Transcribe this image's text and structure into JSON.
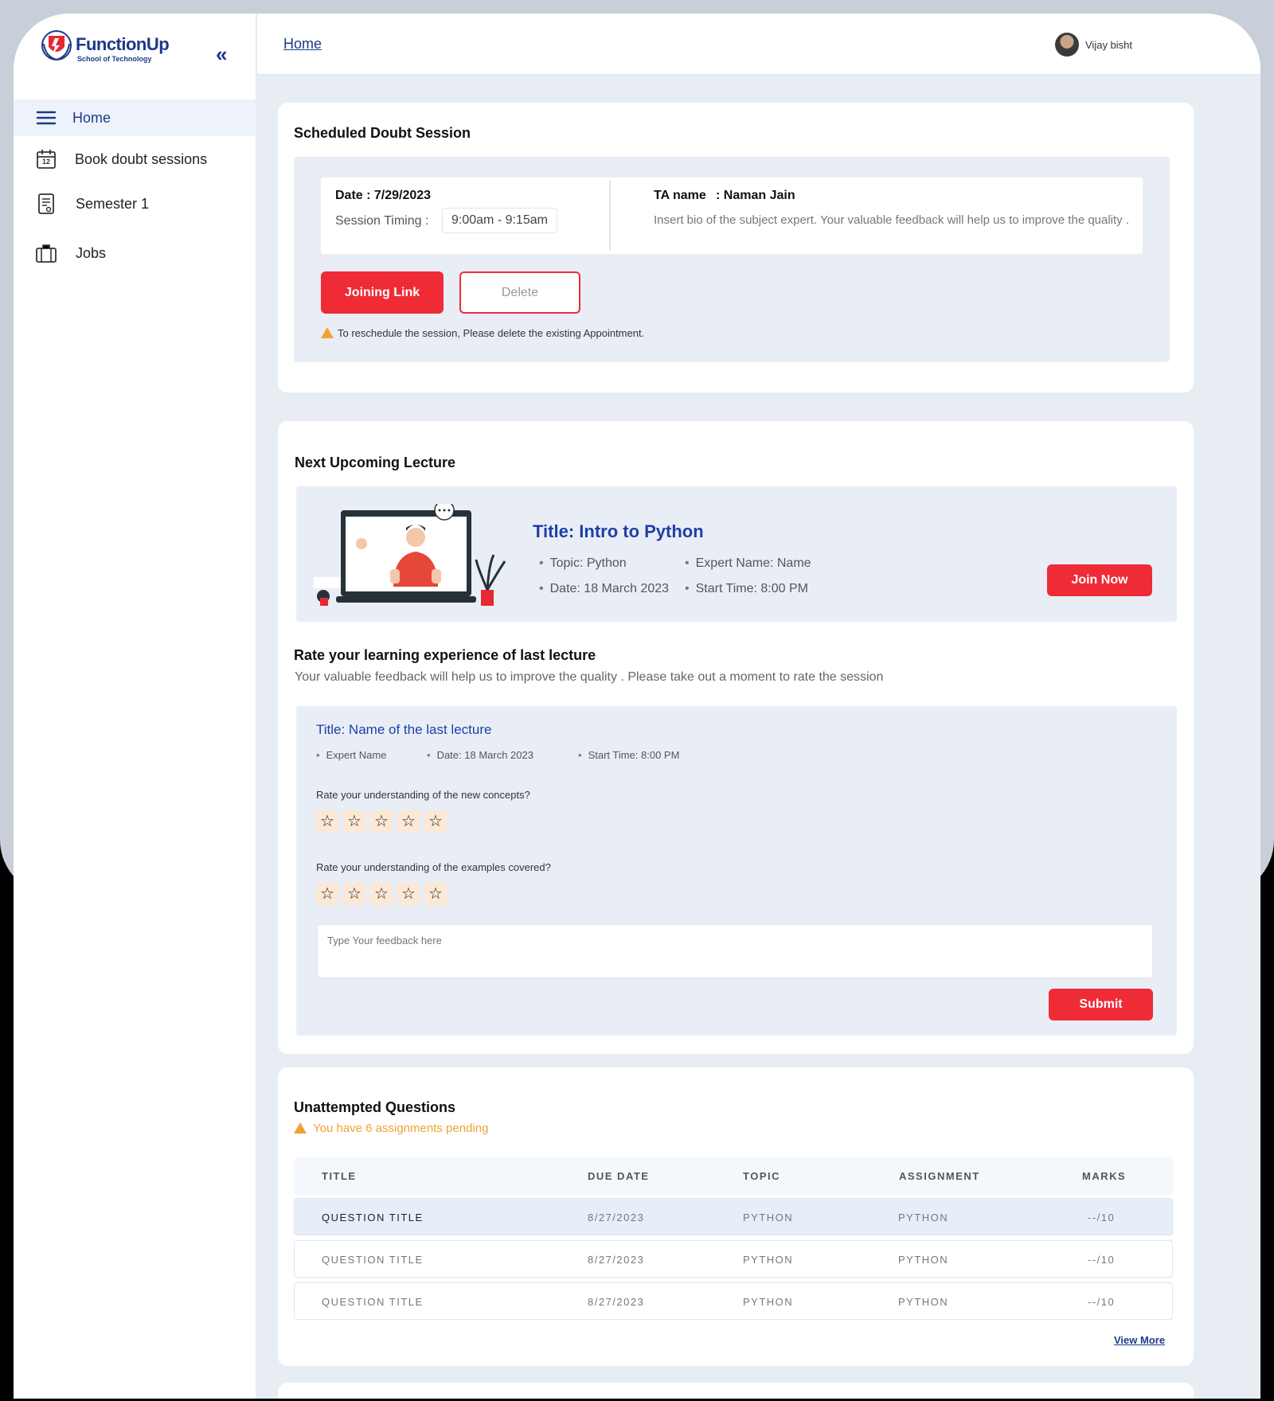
{
  "brand": {
    "name": "FunctionUp",
    "tagline": "School of Technology"
  },
  "sidebar": {
    "items": [
      {
        "label": "Home",
        "icon": "menu-icon",
        "active": true
      },
      {
        "label": "Book doubt sessions",
        "icon": "calendar-icon",
        "calendar_day": "12"
      },
      {
        "label": "Semester 1",
        "icon": "certificate-icon"
      },
      {
        "label": "Jobs",
        "icon": "briefcase-icon"
      }
    ]
  },
  "header": {
    "breadcrumb": "Home",
    "user_name": "Vijay bisht"
  },
  "scheduled": {
    "title": "Scheduled Doubt Session",
    "date": "Date : 7/29/2023",
    "timing_label": "Session Timing :",
    "timing_value": "9:00am - 9:15am",
    "ta_label": "TA name",
    "ta_value": ": Naman Jain",
    "bio": "Insert bio of the subject expert. Your valuable feedback will help us to improve the quality .",
    "join_button": "Joining Link",
    "delete_button": "Delete",
    "warning": "To reschedule the session, Please delete the existing Appointment."
  },
  "upcoming": {
    "title": "Next Upcoming Lecture",
    "lecture_title": "Title: Intro to Python",
    "topic": "Topic: Python",
    "expert": "Expert Name: Name",
    "date": "Date: 18 March 2023",
    "start_time": "Start Time: 8:00 PM",
    "join_button": "Join Now"
  },
  "rating": {
    "title": "Rate your learning experience of last lecture",
    "subtitle": "Your valuable feedback will help us to improve the quality . Please take out a moment to rate the session",
    "lecture_title": "Title: Name of the last lecture",
    "expert": "Expert Name",
    "date": "Date: 18 March 2023",
    "start_time": "Start Time: 8:00 PM",
    "q1": "Rate your understanding of the new concepts?",
    "q2": "Rate your understanding of the examples covered?",
    "q1_rating": 0,
    "q2_rating": 0,
    "max_rating": 5,
    "feedback_placeholder": "Type Your feedback here",
    "submit_button": "Submit"
  },
  "unattempted": {
    "title": "Unattempted Questions",
    "pending": "You have 6 assignments pending",
    "columns": [
      "TITLE",
      "DUE DATE",
      "TOPIC",
      "ASSIGNMENT",
      "MARKS"
    ],
    "rows": [
      [
        "QUESTION TITLE",
        "8/27/2023",
        "PYTHON",
        "PYTHON",
        "--/10"
      ],
      [
        "QUESTION TITLE",
        "8/27/2023",
        "PYTHON",
        "PYTHON",
        "--/10"
      ],
      [
        "QUESTION TITLE",
        "8/27/2023",
        "PYTHON",
        "PYTHON",
        "--/10"
      ]
    ],
    "view_more": "View More"
  },
  "colors": {
    "accent_red": "#ef2b36",
    "brand_blue": "#1d3a8a",
    "warning": "#f0a233",
    "background": "#e8edf4"
  }
}
